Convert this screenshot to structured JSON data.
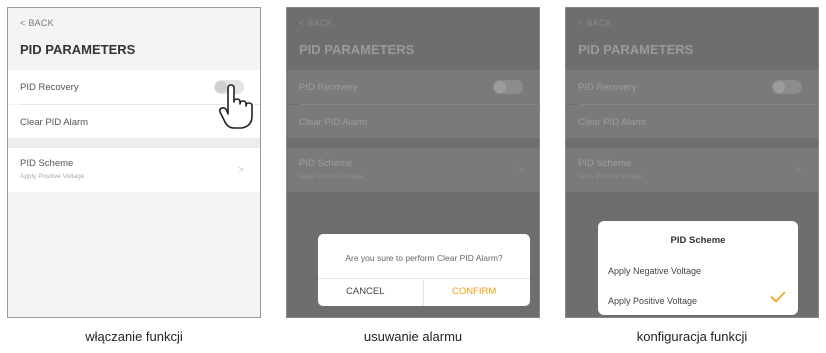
{
  "screens": [
    {
      "back_label": "BACK",
      "title": "PID PARAMETERS",
      "pid_recovery_label": "PID Recovery",
      "clear_alarm_label": "Clear PID Alarm",
      "pid_scheme_label": "PID Scheme",
      "pid_scheme_value": "Apply Positive Voltage",
      "caption": "włączanie funkcji"
    },
    {
      "back_label": "BACK",
      "title": "PID PARAMETERS",
      "pid_recovery_label": "PID Recovery",
      "clear_alarm_label": "Clear PID Alarm",
      "pid_scheme_label": "PID Scheme",
      "pid_scheme_value": "Apply Positive Voltage",
      "dialog": {
        "message": "Are you sure to perform Clear PID Alarm?",
        "cancel_label": "CANCEL",
        "confirm_label": "CONFIRM"
      },
      "caption": "usuwanie alarmu"
    },
    {
      "back_label": "BACK",
      "title": "PID PARAMETERS",
      "pid_recovery_label": "PID Recovery",
      "clear_alarm_label": "Clear PID Alarm",
      "pid_scheme_label": "PID Scheme",
      "pid_scheme_value": "Apply Positive Voltage",
      "sheet": {
        "title": "PID Scheme",
        "options": [
          "Apply Negative Voltage",
          "Apply Positive Voltage"
        ],
        "selected": "Apply Positive Voltage"
      },
      "caption": "konfiguracja funkcji"
    }
  ],
  "colors": {
    "accent": "#f39c12",
    "dim_overlay": "#6e6e6e"
  },
  "icons": [
    "chevron-left-icon",
    "toggle-switch",
    "chevron-right-icon",
    "pointing-hand-icon",
    "checkmark-icon"
  ]
}
